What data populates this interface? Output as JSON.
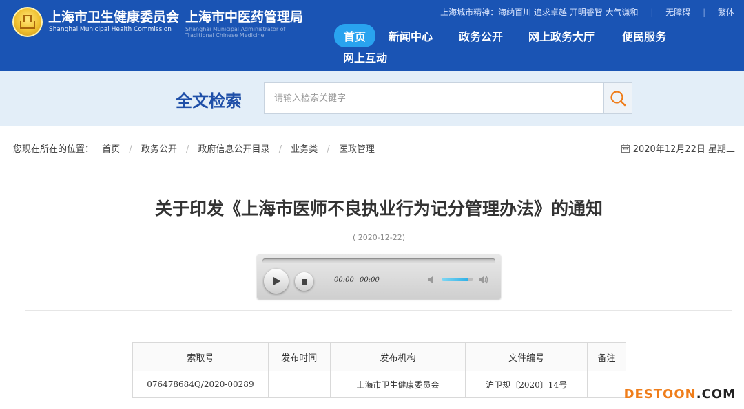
{
  "header": {
    "org1_cn": "上海市卫生健康委员会",
    "org1_en": "Shanghai Municipal Health Commission",
    "org2_cn": "上海市中医药管理局",
    "org2_en_line1": "Shanghai Municipal Administrator of",
    "org2_en_line2": "Traditional Chinese Medicine",
    "motto": "上海城市精神：海纳百川 追求卓越 开明睿智 大气谦和",
    "accessibility": "无障碍",
    "traditional": "繁体"
  },
  "nav": {
    "items": [
      "首页",
      "新闻中心",
      "政务公开",
      "网上政务大厅",
      "便民服务",
      "网上互动"
    ],
    "active_color": "#29a3ef"
  },
  "search": {
    "title": "全文检索",
    "placeholder": "请输入检索关键字"
  },
  "breadcrumb": {
    "label": "您现在所在的位置：",
    "items": [
      "首页",
      "政务公开",
      "政府信息公开目录",
      "业务类",
      "医政管理"
    ],
    "date": "2020年12月22日 星期二"
  },
  "article": {
    "title": "关于印发《上海市医师不良执业行为记分管理办法》的通知",
    "date": "( 2020-12-22)"
  },
  "player": {
    "current_time": "00:00",
    "total_time": "00:00",
    "volume": 0.85
  },
  "meta_table": {
    "headers": [
      "索取号",
      "发布时间",
      "发布机构",
      "文件编号",
      "备注"
    ],
    "row": [
      "076478684Q/2020-00289",
      "",
      "上海市卫生健康委员会",
      "沪卫规〔2020〕14号",
      ""
    ]
  },
  "watermark": {
    "part1": "DESTOON",
    "part2": ".COM"
  },
  "colors": {
    "header_bg": "#1a54b4",
    "search_band": "#e3eef8",
    "search_title": "#1f4fa8",
    "watermark": "#ef7d1a"
  }
}
